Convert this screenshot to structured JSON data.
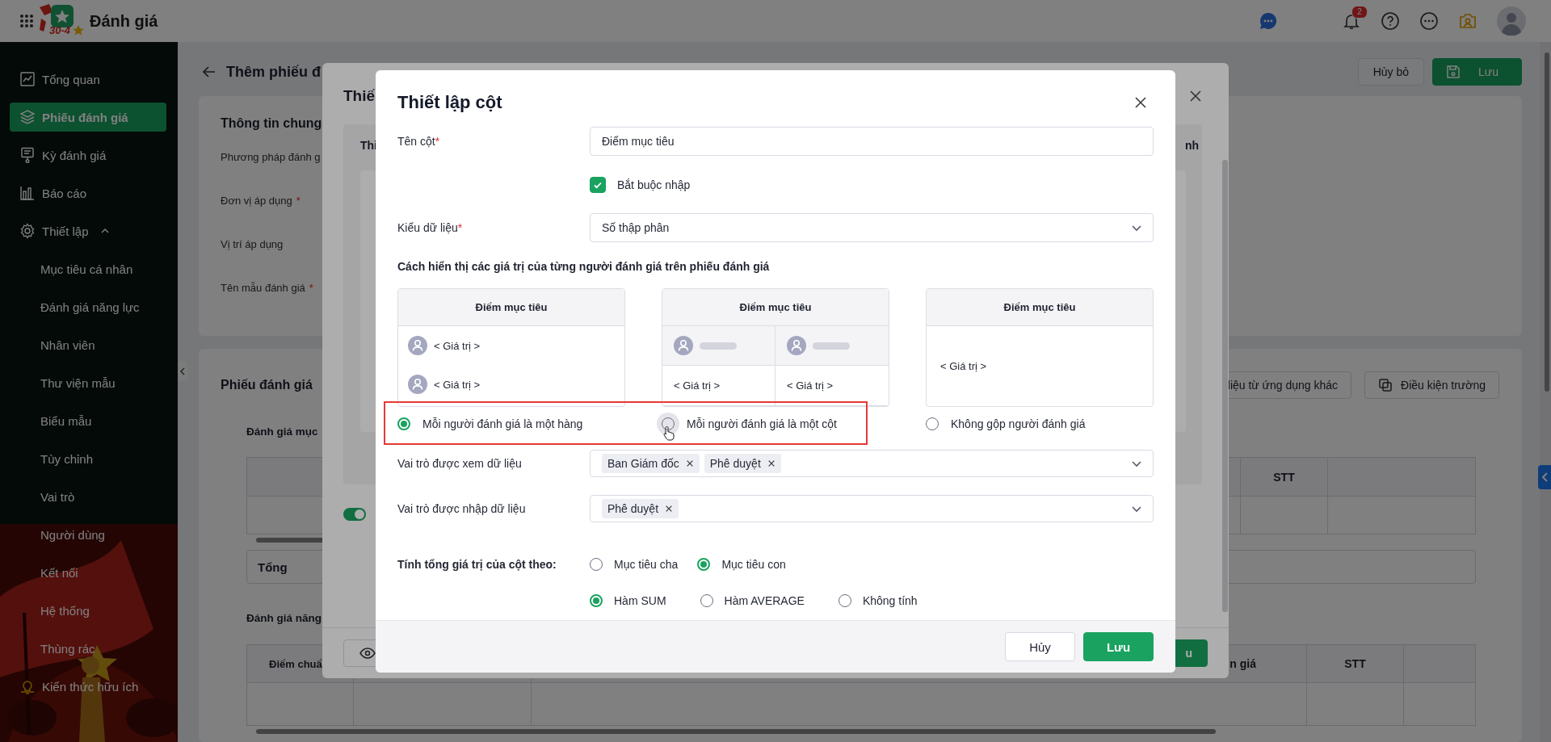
{
  "header": {
    "logo_caption": "30-4",
    "app_title": "Đánh giá",
    "notification_count": "2"
  },
  "sidebar": {
    "items": [
      {
        "label": "Tổng quan",
        "selected": false
      },
      {
        "label": "Phiếu đánh giá",
        "selected": true
      },
      {
        "label": "Kỳ đánh giá",
        "selected": false
      },
      {
        "label": "Báo cáo",
        "selected": false
      },
      {
        "label": "Thiết lập",
        "selected": false,
        "expanded": true,
        "children": [
          {
            "label": "Mục tiêu cá nhân",
            "selected": false
          },
          {
            "label": "Đánh giá năng lực",
            "selected": false
          },
          {
            "label": "Nhân viên",
            "selected": false
          },
          {
            "label": "Thư viện mẫu",
            "selected": false
          },
          {
            "label": "Biểu mẫu",
            "selected": false
          },
          {
            "label": "Tùy chỉnh",
            "selected": false
          },
          {
            "label": "Vai trò",
            "selected": false
          },
          {
            "label": "Người dùng",
            "selected": false
          },
          {
            "label": "Kết nối",
            "selected": false
          },
          {
            "label": "Hệ thống",
            "selected": false
          },
          {
            "label": "Thùng rác",
            "selected": false
          }
        ]
      },
      {
        "label": "Kiến thức hữu ích",
        "selected": false
      }
    ]
  },
  "page": {
    "title": "Thêm phiếu đ",
    "buttons": [
      {
        "label": "Hủy bỏ",
        "kind": "secondary"
      },
      {
        "label": "Lưu",
        "kind": "primary"
      }
    ],
    "general_info": {
      "title": "Thông tin chung",
      "fields": [
        {
          "label": "Phương pháp đánh g"
        },
        {
          "label": "Đơn vị áp dụng",
          "required_mark": "*"
        },
        {
          "label": "Vị trí áp dụng"
        },
        {
          "label": "Tên mẫu đánh giá",
          "required_mark": "*"
        }
      ]
    },
    "evaluation_form": {
      "title": "Phiếu đánh giá",
      "actions": [
        {
          "label": "liệu từ ứng dụng khác",
          "kind": "text"
        },
        {
          "label": "Điều kiện trường",
          "kind": "icon"
        }
      ],
      "goal_section": {
        "title": "Đánh giá mục",
        "stt_header": "STT",
        "total_label": "Tổng"
      },
      "competency_section": {
        "title": "Đánh giá năng",
        "columns": [
          "Điểm chuẩ",
          "n giá",
          "STT"
        ]
      }
    }
  },
  "back_dialog": {
    "title": "Thiế",
    "panel_header_left": "Thi",
    "panel_header_right": "nh",
    "toggle": {
      "on": true
    },
    "save_button": "u"
  },
  "dialog": {
    "title": "Thiết lập cột",
    "name_field": {
      "label": "Tên cột",
      "required_mark": "*",
      "value": "Điểm mục tiêu"
    },
    "required_checkbox": {
      "label": "Bắt buộc nhập",
      "checked": true
    },
    "data_type_field": {
      "label": "Kiểu dữ liệu",
      "required_mark": "*",
      "value": "Số thập phân"
    },
    "display_heading": "Cách hiển thị các giá trị của từng người đánh giá trên phiếu đánh giá",
    "display_options": [
      {
        "kind": "rows",
        "header": "Điểm mục tiêu",
        "values": [
          "< Giá trị >",
          "< Giá trị >"
        ],
        "label": "Mỗi người đánh giá là một hàng",
        "selected": true,
        "hovered": false,
        "highlighted": true
      },
      {
        "kind": "columns",
        "header": "Điểm mục tiêu",
        "values": [
          "< Giá trị >",
          "< Giá trị >"
        ],
        "label": "Mỗi người đánh giá là một cột",
        "selected": false,
        "hovered": true,
        "highlighted": true
      },
      {
        "kind": "merged",
        "header": "Điểm mục tiêu",
        "values": [
          "< Giá trị >"
        ],
        "label": "Không gộp người đánh giá",
        "selected": false,
        "hovered": false,
        "highlighted": false
      }
    ],
    "view_roles": {
      "label": "Vai trò được xem dữ liệu",
      "tags": [
        "Ban Giám đốc",
        "Phê duyệt"
      ]
    },
    "edit_roles": {
      "label": "Vai trò được nhập dữ liệu",
      "tags": [
        "Phê duyệt"
      ]
    },
    "sum_by": {
      "label": "Tính tổng giá trị của cột theo:",
      "options": [
        {
          "label": "Mục tiêu cha",
          "selected": false
        },
        {
          "label": "Mục tiêu con",
          "selected": true
        }
      ]
    },
    "aggregate": {
      "options": [
        {
          "label": "Hàm SUM",
          "selected": true
        },
        {
          "label": "Hàm AVERAGE",
          "selected": false
        },
        {
          "label": "Không tính",
          "selected": false
        }
      ]
    },
    "buttons": [
      {
        "label": "Hủy",
        "kind": "secondary"
      },
      {
        "label": "Lưu",
        "kind": "primary"
      }
    ]
  }
}
